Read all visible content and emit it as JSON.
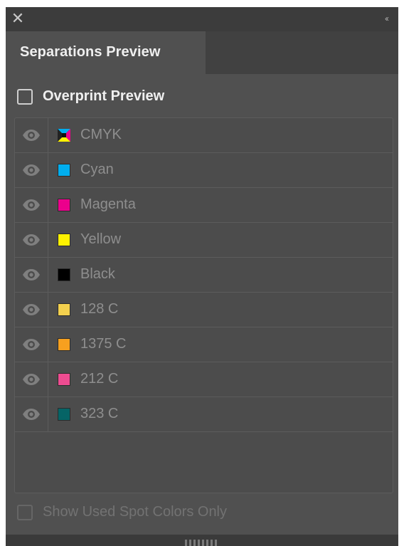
{
  "titlebar": {
    "close_glyph": "✕",
    "collapse_glyph": "‹‹"
  },
  "tab": {
    "label": "Separations Preview"
  },
  "overprint": {
    "label": "Overprint Preview",
    "checked": false
  },
  "separations": [
    {
      "label": "CMYK",
      "color": "#cmyk",
      "visible": true
    },
    {
      "label": "Cyan",
      "color": "#00aeef",
      "visible": true
    },
    {
      "label": "Magenta",
      "color": "#ec008c",
      "visible": true
    },
    {
      "label": "Yellow",
      "color": "#fff200",
      "visible": true
    },
    {
      "label": "Black",
      "color": "#000000",
      "visible": true
    },
    {
      "label": "128 C",
      "color": "#f3d04e",
      "visible": true
    },
    {
      "label": "1375 C",
      "color": "#f7a01f",
      "visible": true
    },
    {
      "label": "212 C",
      "color": "#ee4c91",
      "visible": true
    },
    {
      "label": "323 C",
      "color": "#066466",
      "visible": true
    }
  ],
  "spot_only": {
    "label": "Show Used Spot Colors Only",
    "checked": false,
    "enabled": false
  }
}
